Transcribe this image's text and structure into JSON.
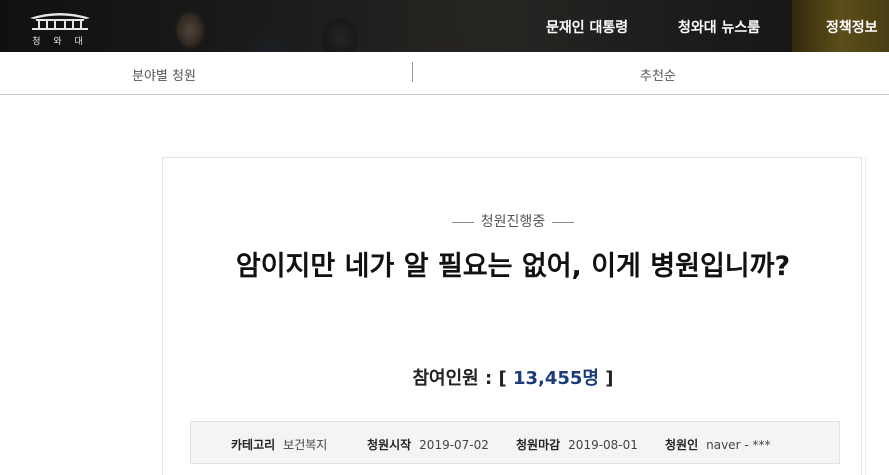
{
  "header": {
    "logo_text": "청 와 대",
    "nav": [
      "문재인 대통령",
      "청와대 뉴스룸",
      "정책정보"
    ]
  },
  "subnav": {
    "category_tab": "분야별 청원",
    "sort_tab": "추천순"
  },
  "petition": {
    "status": "청원진행중",
    "title": "암이지만 네가 알 필요는 없어, 이게 병원입니까?",
    "count_label": "참여인원 : [",
    "count_value": "13,455명",
    "count_close": "]",
    "info": [
      {
        "key": "카테고리",
        "value": "보건복지"
      },
      {
        "key": "청원시작",
        "value": "2019-07-02"
      },
      {
        "key": "청원마감",
        "value": "2019-08-01"
      },
      {
        "key": "청원인",
        "value": "naver - ***"
      }
    ]
  },
  "colors": {
    "count_accent": "#1b3b7a",
    "header_bg": "#2a2a28"
  }
}
